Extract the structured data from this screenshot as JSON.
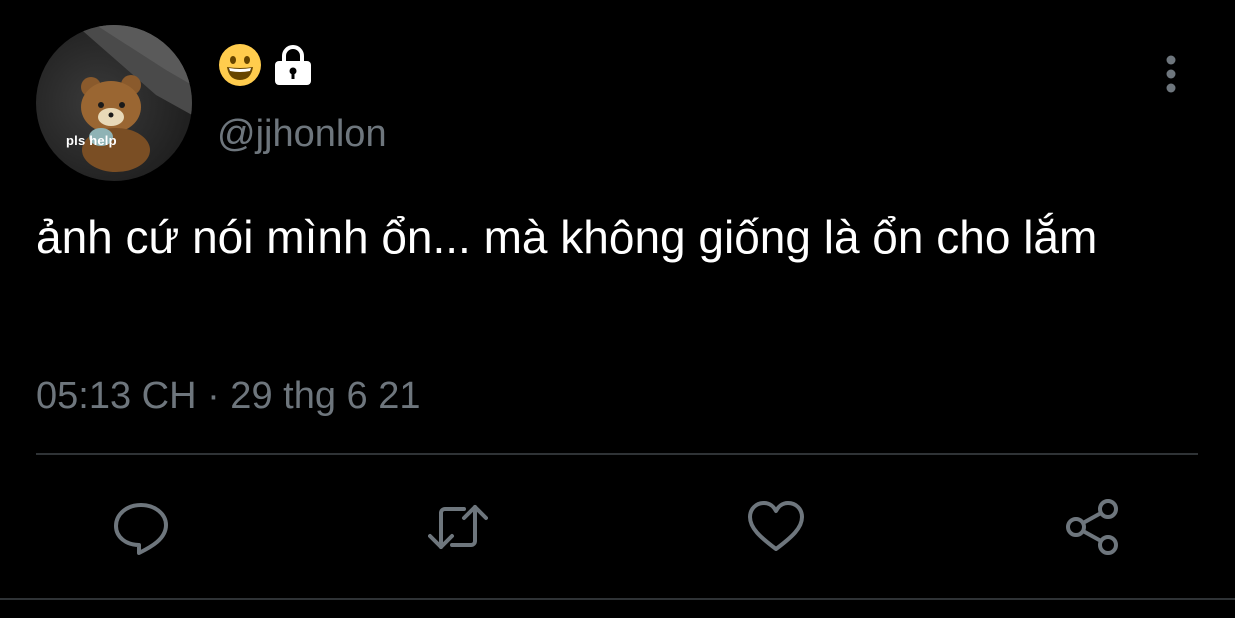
{
  "tweet": {
    "avatar_caption": "pls help",
    "display_name_icons": [
      "grinning-face-emoji",
      "lock-icon"
    ],
    "handle": "@jjhonlon",
    "text": "ảnh cứ nói mình ổn... mà không giống là ổn cho lắm",
    "timestamp": "05:13 CH · 29 thg 6 21"
  },
  "actions": [
    {
      "name": "reply",
      "icon": "speech-bubble-icon"
    },
    {
      "name": "retweet",
      "icon": "retweet-arrows-icon"
    },
    {
      "name": "like",
      "icon": "heart-icon"
    },
    {
      "name": "share",
      "icon": "share-nodes-icon"
    }
  ],
  "colors": {
    "background": "#000000",
    "text_primary": "#ffffff",
    "text_secondary": "#6e767d",
    "divider": "#2f3336",
    "emoji_yellow": "#ffcc4d"
  }
}
